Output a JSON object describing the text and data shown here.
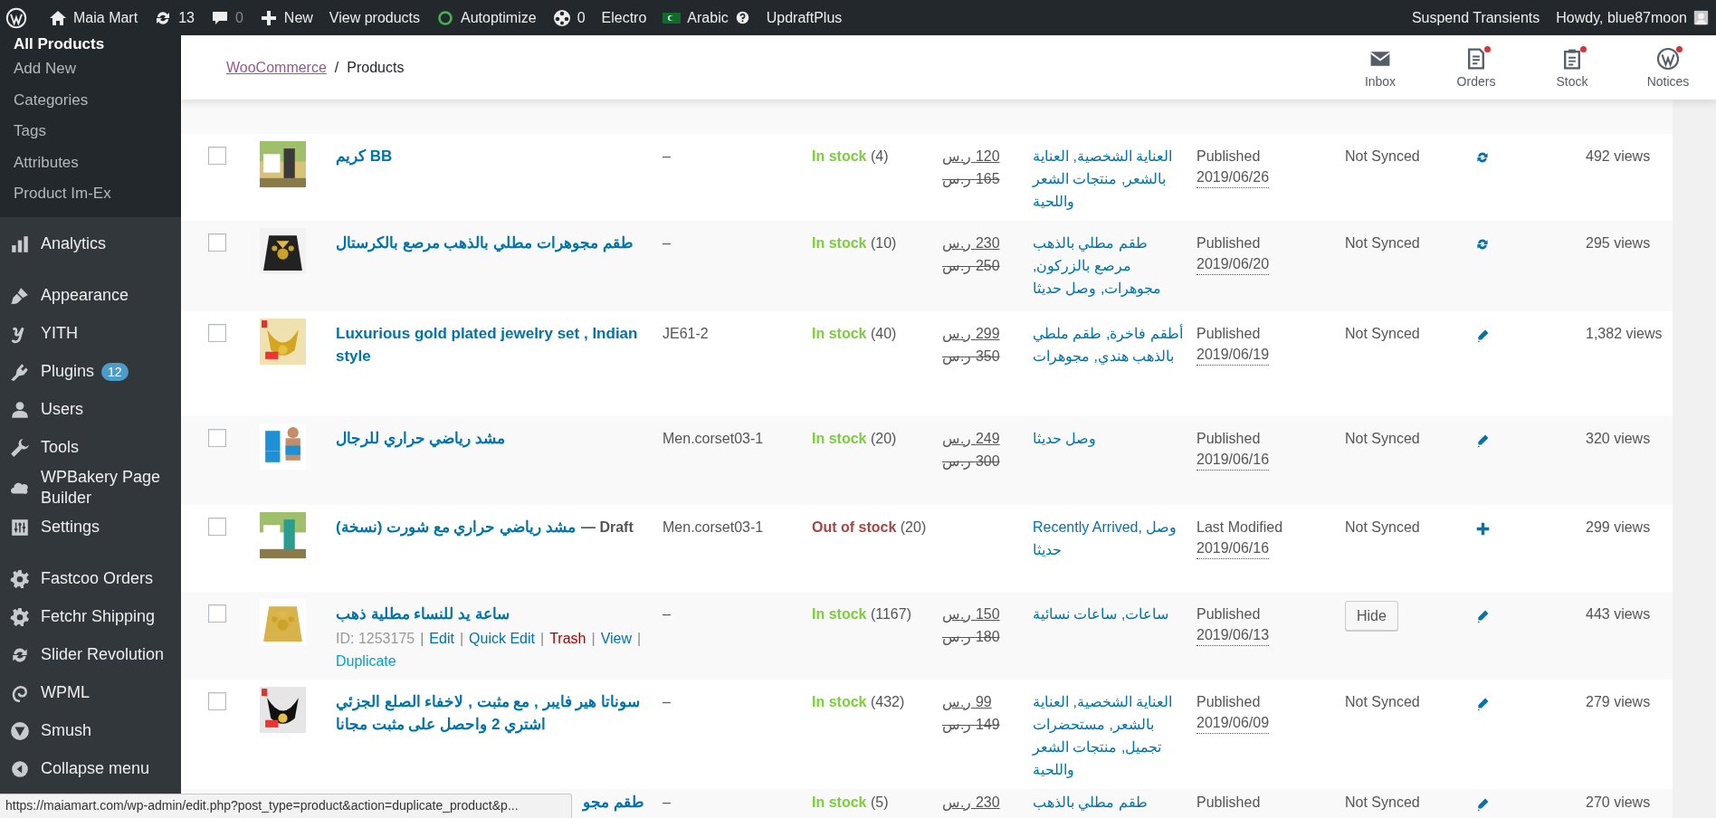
{
  "admin_bar": {
    "left": [
      {
        "kind": "logo"
      },
      {
        "kind": "item",
        "label": "Maia Mart"
      },
      {
        "kind": "item",
        "label": "13"
      },
      {
        "kind": "count",
        "label": "0"
      },
      {
        "kind": "item",
        "label": "New"
      },
      {
        "kind": "item",
        "label": "View products"
      },
      {
        "kind": "item",
        "label": "Autoptimize"
      },
      {
        "kind": "item",
        "label": "0"
      },
      {
        "kind": "item",
        "label": "Electro"
      },
      {
        "kind": "item",
        "label": "Arabic"
      },
      {
        "kind": "item",
        "label": "UpdraftPlus"
      }
    ],
    "right": [
      {
        "label": "Suspend Transients"
      },
      {
        "label": "Howdy, blue87moon"
      }
    ]
  },
  "sidebar": {
    "submenu": [
      {
        "label": "All Products",
        "selected": true
      },
      {
        "label": "Add New",
        "selected": false
      },
      {
        "label": "Categories",
        "selected": false
      },
      {
        "label": "Tags",
        "selected": false
      },
      {
        "label": "Attributes",
        "selected": false
      },
      {
        "label": "Product Im-Ex",
        "selected": false
      }
    ],
    "menu_groups": [
      [
        {
          "label": "Analytics"
        }
      ],
      [
        {
          "label": "Appearance"
        },
        {
          "label": "YITH"
        },
        {
          "label": "Plugins",
          "badge": "12"
        },
        {
          "label": "Users"
        },
        {
          "label": "Tools"
        },
        {
          "label": "WPBakery Page Builder"
        },
        {
          "label": "Settings"
        }
      ],
      [
        {
          "label": "Fastcoo Orders"
        },
        {
          "label": "Fetchr Shipping"
        },
        {
          "label": "Slider Revolution"
        },
        {
          "label": "WPML"
        },
        {
          "label": "Smush"
        },
        {
          "label": "Collapse menu"
        }
      ]
    ]
  },
  "header": {
    "breadcrumb": {
      "link": "WooCommerce",
      "separator": "/",
      "current": "Products"
    },
    "actions": [
      {
        "label": "Inbox",
        "dot": false
      },
      {
        "label": "Orders",
        "dot": true
      },
      {
        "label": "Stock",
        "dot": true
      },
      {
        "label": "Notices",
        "dot": true
      }
    ]
  },
  "products": {
    "row_action_separator": "|",
    "rows": [
      {
        "selected": false,
        "name": "كريم BB",
        "sku": "–",
        "stock": {
          "kind": "in",
          "label": "In stock",
          "count": "(4)"
        },
        "price": {
          "sale": "120 ر.س",
          "regular": "165 ر.س"
        },
        "categories": "العناية الشخصية, العناية بالشعر, منتجات الشعر واللحية",
        "date": {
          "label": "Published",
          "value": "2019/06/26"
        },
        "sync": {
          "kind": "text",
          "label": "Not Synced"
        },
        "action": {
          "kind": "refresh"
        },
        "views": "492 views"
      },
      {
        "selected": false,
        "name": "طقم مجوهرات مطلي بالذهب مرصع بالكرستال",
        "sku": "–",
        "stock": {
          "kind": "in",
          "label": "In stock",
          "count": "(10)"
        },
        "price": {
          "sale": "230 ر.س",
          "regular": "250 ر.س"
        },
        "categories": "طقم مطلي بالذهب مرصع بالزركون, مجوهرات, وصل حديثا",
        "date": {
          "label": "Published",
          "value": "2019/06/20"
        },
        "sync": {
          "kind": "text",
          "label": "Not Synced"
        },
        "action": {
          "kind": "refresh"
        },
        "views": "295 views"
      },
      {
        "selected": false,
        "name": "Luxurious gold plated jewelry set , Indian style",
        "sku": "JE61-2",
        "stock": {
          "kind": "in",
          "label": "In stock",
          "count": "(40)"
        },
        "price": {
          "sale": "299 ر.س",
          "regular": "350 ر.س"
        },
        "categories": "أطقم فاخرة, طقم ملطي بالذهب هندي, مجوهرات",
        "date": {
          "label": "Published",
          "value": "2019/06/19"
        },
        "sync": {
          "kind": "text",
          "label": "Not Synced"
        },
        "action": {
          "kind": "edit"
        },
        "views": "1,382 views"
      },
      {
        "selected": false,
        "name": "مشد رياضي حراري للرجال",
        "sku": "Men.corset03-1",
        "stock": {
          "kind": "in",
          "label": "In stock",
          "count": "(20)"
        },
        "price": {
          "sale": "249 ر.س",
          "regular": "300 ر.س"
        },
        "categories": "وصل حديثا",
        "date": {
          "label": "Published",
          "value": "2019/06/16"
        },
        "sync": {
          "kind": "text",
          "label": "Not Synced"
        },
        "action": {
          "kind": "edit"
        },
        "views": "320 views"
      },
      {
        "selected": false,
        "name": "مشد رياضي حراري مع شورت (نسخة)",
        "post_state": "— Draft",
        "sku": "Men.corset03-1",
        "stock": {
          "kind": "out",
          "label": "Out of stock",
          "count": "(20)"
        },
        "categories": "Recently Arrived, وصل حديثا",
        "date": {
          "label": "Last Modified",
          "value": "2019/06/16"
        },
        "sync": {
          "kind": "text",
          "label": "Not Synced"
        },
        "action": {
          "kind": "add"
        },
        "views": "299 views"
      },
      {
        "selected": false,
        "name": "ساعة يد للنساء مطلية ذهب",
        "row_actions": [
          {
            "kind": "id",
            "label": "ID: 1253175"
          },
          {
            "kind": "link",
            "label": "Edit"
          },
          {
            "kind": "link",
            "label": "Quick Edit"
          },
          {
            "kind": "danger",
            "label": "Trash"
          },
          {
            "kind": "link",
            "label": "View"
          },
          {
            "kind": "hover",
            "label": "Duplicate"
          }
        ],
        "sku": "–",
        "stock": {
          "kind": "in",
          "label": "In stock",
          "count": "(1167)"
        },
        "price": {
          "sale": "150 ر.س",
          "regular": "180 ر.س"
        },
        "categories": "ساعات, ساعات نسائية",
        "date": {
          "label": "Published",
          "value": "2019/06/13"
        },
        "sync": {
          "kind": "button",
          "label": "Hide"
        },
        "action": {
          "kind": "edit"
        },
        "views": "443 views"
      },
      {
        "selected": false,
        "name": "سوناتا هير فايبر , مع مثبت , لاخفاء الصلع الجزئي اشتري 2 واحصل على مثبت مجانا",
        "sku": "–",
        "stock": {
          "kind": "in",
          "label": "In stock",
          "count": "(432)"
        },
        "price": {
          "sale": "99 ر.س",
          "regular": "149 ر.س"
        },
        "categories": "العناية الشخصية, العناية بالشعر, مستحضرات تجميل, منتجات الشعر واللحية",
        "date": {
          "label": "Published",
          "value": "2019/06/09"
        },
        "sync": {
          "kind": "text",
          "label": "Not Synced"
        },
        "action": {
          "kind": "edit"
        },
        "views": "279 views"
      },
      {
        "name": "طقم مجو",
        "sku": "–",
        "stock": {
          "kind": "in",
          "label": "In stock",
          "count": "(5)"
        },
        "price": {
          "sale": "230 ر.س"
        },
        "categories": "طقم مطلي بالذهب",
        "date": {
          "label": "Published"
        },
        "sync": {
          "kind": "text",
          "label": "Not Synced"
        },
        "action": {
          "kind": "edit"
        },
        "views": "270 views"
      }
    ]
  },
  "status_url": "https://maiamart.com/wp-admin/edit.php?post_type=product&action=duplicate_product&p..."
}
